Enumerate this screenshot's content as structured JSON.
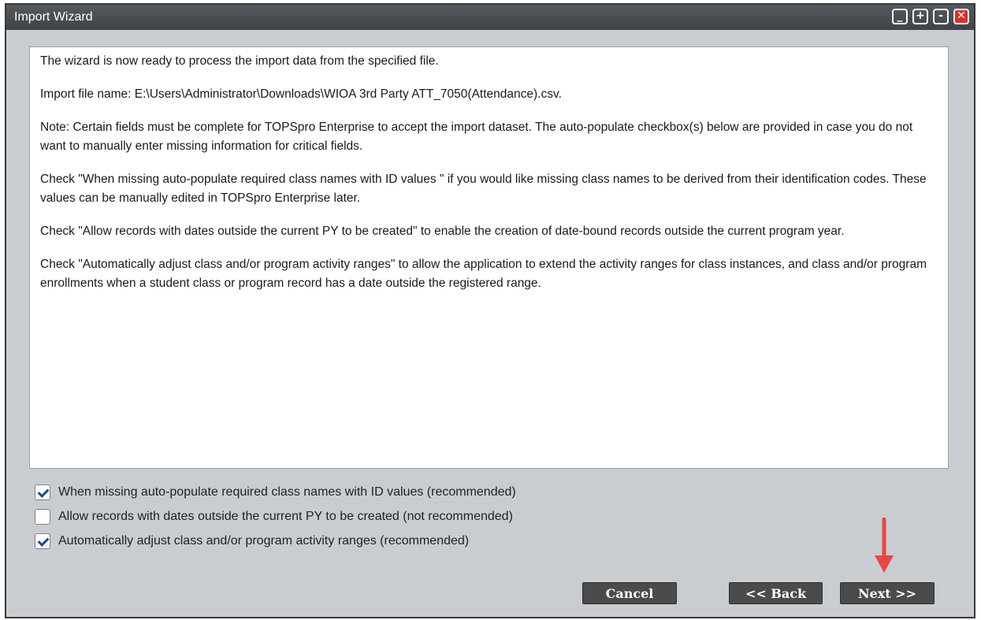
{
  "window": {
    "title": "Import Wizard"
  },
  "title_buttons": {
    "minimize": "_",
    "maximize": "+",
    "restore": "-",
    "close": "✕"
  },
  "content": {
    "p1": "The wizard is now ready to process the import data from the specified file.",
    "p2": "Import file name: E:\\Users\\Administrator\\Downloads\\WIOA 3rd Party ATT_7050(Attendance).csv.",
    "p3": "Note: Certain fields must be complete for TOPSpro Enterprise to accept the import dataset. The auto-populate checkbox(s) below are provided in case you do not want to manually enter missing information for critical fields.",
    "p4": "Check \"When missing auto-populate required class names with ID values \" if you would like missing class names to be derived from their identification codes. These values can be manually edited in TOPSpro Enterprise later.",
    "p5": "Check \"Allow records with dates outside the current PY to be created\" to enable the creation of date-bound records outside the current program year.",
    "p6": "Check \"Automatically adjust class and/or program activity ranges\" to allow the application to extend the activity ranges for class instances, and class and/or program enrollments when a student class or program record has a date outside the registered range."
  },
  "checkboxes": [
    {
      "label": "When missing auto-populate required class names with ID values (recommended)",
      "checked": true
    },
    {
      "label": "Allow records with dates outside the current PY to be created (not recommended)",
      "checked": false
    },
    {
      "label": "Automatically adjust class and/or program activity ranges (recommended)",
      "checked": true
    }
  ],
  "buttons": {
    "cancel": "Cancel",
    "back": "<< Back",
    "next": "Next >>"
  },
  "colors": {
    "arrow": "#e8473f",
    "close": "#d9302b",
    "button": "#4b4b4b"
  }
}
